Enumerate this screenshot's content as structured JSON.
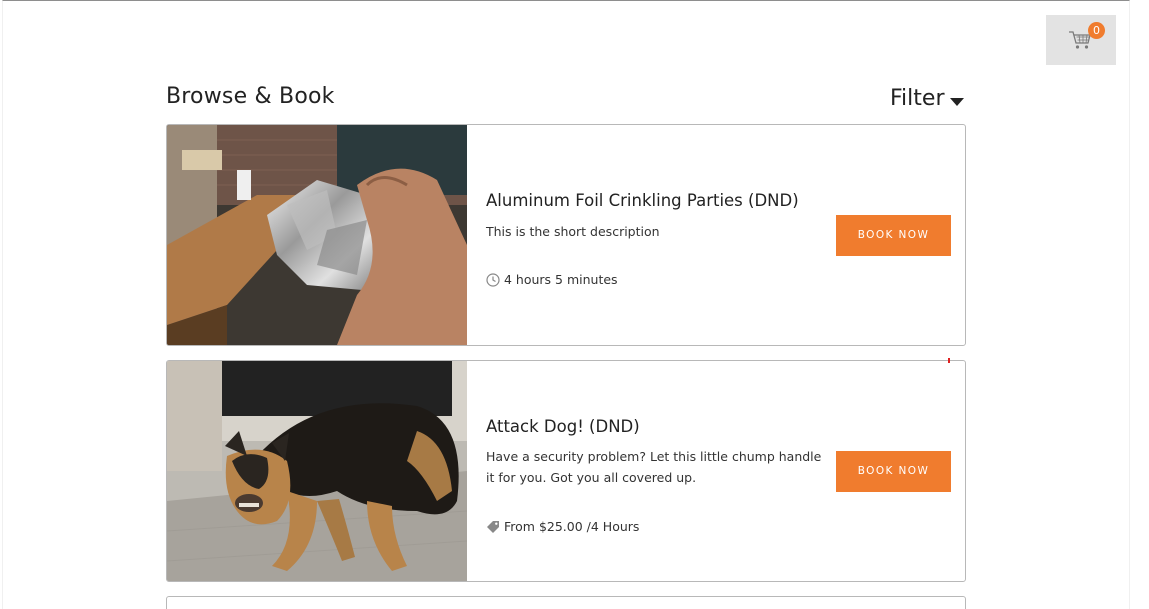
{
  "header": {
    "title": "Browse & Book",
    "filter_label": "Filter",
    "cart_count": "0"
  },
  "colors": {
    "accent": "#f07c2e",
    "cart_bg": "#e3e3e3",
    "card_border": "#b8b8b8"
  },
  "services": [
    {
      "name": "Aluminum Foil Crinkling Parties (DND)",
      "description": "This is the short description",
      "meta_icon": "clock-icon",
      "meta": "4 hours 5 minutes",
      "button_label": "BOOK NOW",
      "image": "hand crinkling aluminum foil at a bar"
    },
    {
      "name": "Attack Dog! (DND)",
      "description": "Have a security problem? Let this little chump handle it for you. Got you all covered up.",
      "meta_icon": "price-tag-icon",
      "meta": "From $25.00 /4 Hours",
      "button_label": "BOOK NOW",
      "image": "snarling german shepherd dog"
    }
  ]
}
